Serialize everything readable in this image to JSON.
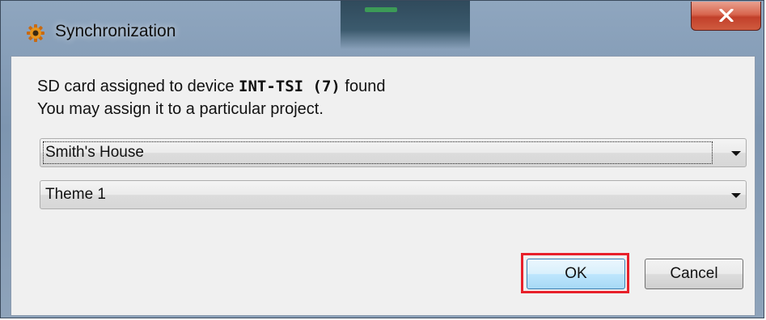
{
  "window": {
    "title": "Synchronization",
    "icon": "sync-gear-icon",
    "close_icon": "close-icon"
  },
  "message": {
    "line1_prefix": "SD card assigned to device ",
    "line1_device": "INT-TSI (7)",
    "line1_suffix": " found",
    "line2": "You may assign it to a particular project."
  },
  "project_select": {
    "selected": "Smith's House"
  },
  "theme_select": {
    "selected": "Theme 1"
  },
  "buttons": {
    "ok_label": "OK",
    "cancel_label": "Cancel"
  },
  "colors": {
    "highlight": "#e8202a",
    "close_button": "#c2402a"
  }
}
